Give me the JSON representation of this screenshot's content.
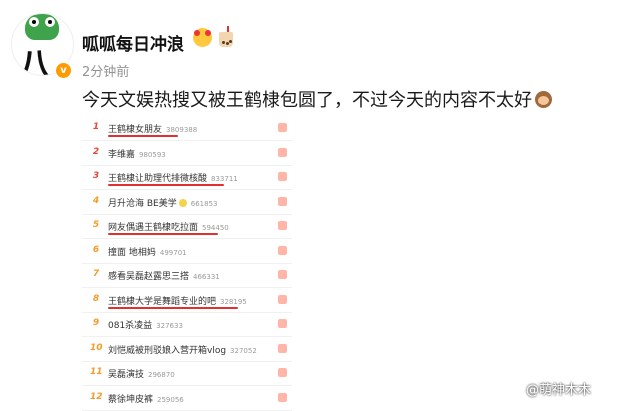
{
  "post": {
    "username": "呱呱每日冲浪",
    "timestamp": "2分钟前",
    "text": "今天文娱热搜又被王鹤棣包圆了，不过今天的内容不太好",
    "verified_badge": "v",
    "avatar_text": "八卦"
  },
  "hot_list": [
    {
      "rank": "1",
      "title": "王鹤棣女朋友",
      "count": "3809388"
    },
    {
      "rank": "2",
      "title": "李维嘉",
      "count": "980593"
    },
    {
      "rank": "3",
      "title": "王鹤棣让助理代排微核酸",
      "count": "833711"
    },
    {
      "rank": "4",
      "title": "月升沧海 BE美学",
      "count": "661853"
    },
    {
      "rank": "5",
      "title": "网友偶遇王鹤棣吃拉面",
      "count": "594450"
    },
    {
      "rank": "6",
      "title": "撞面 地相妈",
      "count": "499701"
    },
    {
      "rank": "7",
      "title": "感看吴磊赵露思三搭",
      "count": "466331"
    },
    {
      "rank": "8",
      "title": "王鹤棣大学是舞蹈专业的吧",
      "count": "328195"
    },
    {
      "rank": "9",
      "title": "081杀凌益",
      "count": "327633"
    },
    {
      "rank": "10",
      "title": "刘恺威被刑驳娘入营开箱vlog",
      "count": "327052"
    },
    {
      "rank": "11",
      "title": "吴磊演技",
      "count": "296870"
    },
    {
      "rank": "12",
      "title": "蔡徐坤皮裤",
      "count": "259056"
    }
  ],
  "watermark": "@萌神木木",
  "colors": {
    "rank_top": "#e8493b",
    "rank_other": "#f39c2c",
    "underline": "#e03030",
    "badge": "#ff9b00"
  }
}
